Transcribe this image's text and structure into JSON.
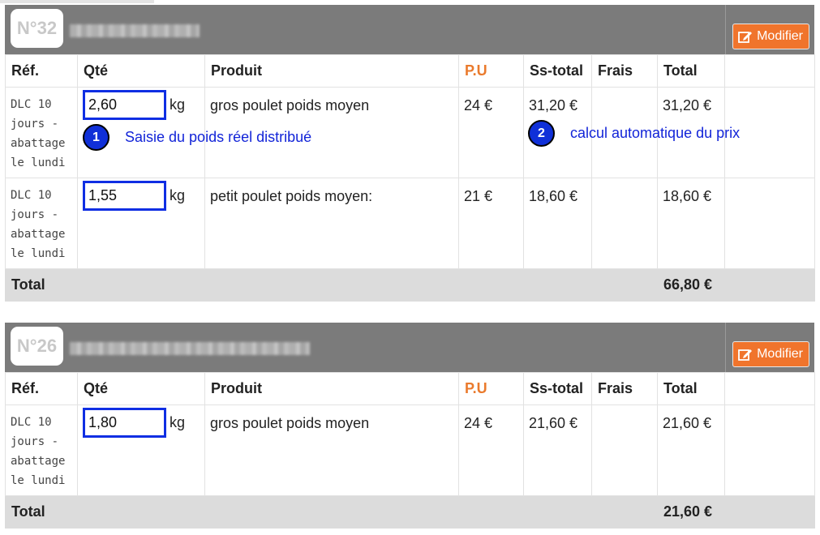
{
  "columns": {
    "ref": "Réf.",
    "qty": "Qté",
    "product": "Produit",
    "pu": "P.U",
    "subtotal": "Ss-total",
    "fees": "Frais",
    "total": "Total"
  },
  "edit_label": "Modifier",
  "total_label": "Total",
  "orders": [
    {
      "number": "N°32",
      "rows": [
        {
          "ref": "DLC 10 jours - abattage le lundi",
          "qty": "2,60",
          "unit": "kg",
          "product": "gros poulet poids moyen",
          "pu": "24 €",
          "subtotal": "31,20 €",
          "fees": "",
          "total": "31,20 €"
        },
        {
          "ref": "DLC 10 jours - abattage le lundi",
          "qty": "1,55",
          "unit": "kg",
          "product": "petit poulet poids moyen:",
          "pu": "21 €",
          "subtotal": "18,60 €",
          "fees": "",
          "total": "18,60 €"
        }
      ],
      "grand_total": "66,80 €"
    },
    {
      "number": "N°26",
      "rows": [
        {
          "ref": "DLC 10 jours - abattage le lundi",
          "qty": "1,80",
          "unit": "kg",
          "product": "gros poulet poids moyen",
          "pu": "24 €",
          "subtotal": "21,60 €",
          "fees": "",
          "total": "21,60 €"
        }
      ],
      "grand_total": "21,60 €"
    }
  ],
  "annotations": [
    {
      "number": "1",
      "text": "Saisie du poids réel distribué"
    },
    {
      "number": "2",
      "text": "calcul automatique du prix"
    }
  ]
}
